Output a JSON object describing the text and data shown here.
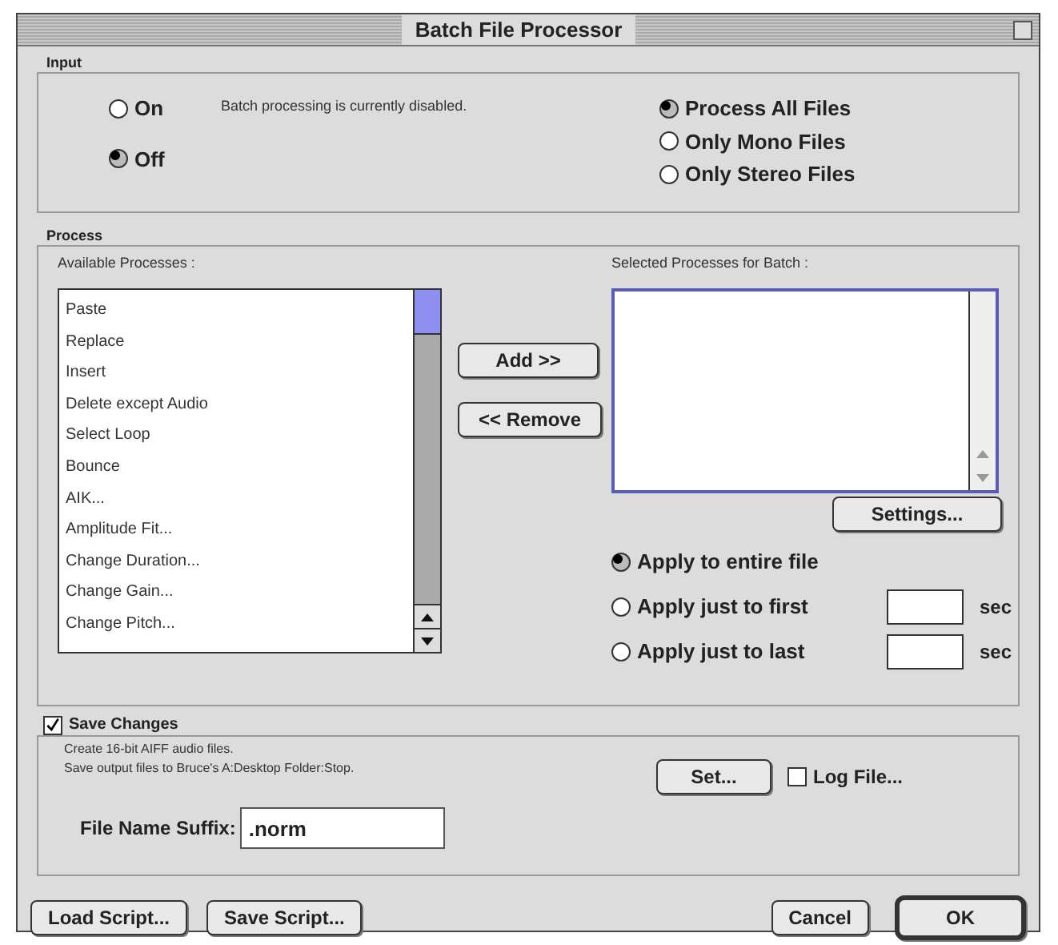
{
  "window": {
    "title": "Batch File Processor"
  },
  "input": {
    "label": "Input",
    "modes": [
      {
        "label": "On",
        "selected": false
      },
      {
        "label": "Off",
        "selected": true
      }
    ],
    "status": "Batch processing is currently disabled.",
    "filters": [
      {
        "label": "Process All Files",
        "selected": true
      },
      {
        "label": "Only Mono Files",
        "selected": false
      },
      {
        "label": "Only Stereo Files",
        "selected": false
      }
    ]
  },
  "process": {
    "label": "Process",
    "available_label": "Available Processes :",
    "available": [
      "Paste",
      "Replace",
      "Insert",
      "Delete except Audio",
      "Select Loop",
      "Bounce",
      "AIK...",
      "Amplitude Fit...",
      "Change Duration...",
      "Change Gain...",
      "Change Pitch..."
    ],
    "add_button": "Add >>",
    "remove_button": "<< Remove",
    "selected_label": "Selected Processes for Batch :",
    "settings_button": "Settings...",
    "apply": [
      {
        "label": "Apply to entire file",
        "selected": true
      },
      {
        "label": "Apply just to first",
        "selected": false,
        "unit": "sec"
      },
      {
        "label": "Apply just to last",
        "selected": false,
        "unit": "sec"
      }
    ]
  },
  "save": {
    "label": "Save Changes",
    "checked": true,
    "lines": [
      "Create 16-bit AIFF audio files.",
      "Save output files to Bruce's A:Desktop Folder:Stop."
    ],
    "set_button": "Set...",
    "log_file": {
      "label": "Log File...",
      "checked": false
    },
    "suffix_label": "File Name Suffix:",
    "suffix_value": ".norm"
  },
  "buttons": [
    {
      "label": "Load Script...",
      "kind": "plain"
    },
    {
      "label": "Save Script...",
      "kind": "plain"
    },
    {
      "label": "Cancel",
      "kind": "plain"
    },
    {
      "label": "OK",
      "kind": "default"
    }
  ]
}
